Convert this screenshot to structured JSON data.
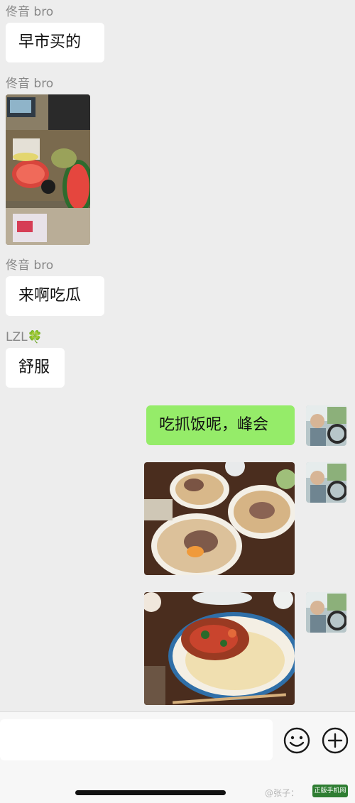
{
  "messages": [
    {
      "sender": "佟音 bro",
      "text": "早市买的"
    },
    {
      "sender": "佟音 bro",
      "image_label": "market-photo"
    },
    {
      "sender": "佟音 bro",
      "text": "来啊吃瓜"
    },
    {
      "sender": "LZL🍀",
      "text": "舒服"
    }
  ],
  "my_messages": [
    {
      "text": "吃抓饭呢，峰会"
    }
  ],
  "composer": {
    "emoji_icon": "smiley-icon",
    "plus_icon": "plus-icon"
  },
  "watermark": "@张子：",
  "badge": "正版手机网",
  "colors": {
    "background": "#ededed",
    "bubble_other": "#ffffff",
    "bubble_mine": "#95ec69",
    "sender_name": "#888888"
  }
}
